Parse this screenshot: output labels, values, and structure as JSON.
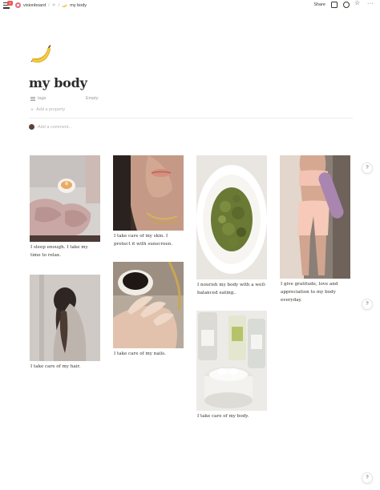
{
  "topbar": {
    "notification_count": "1",
    "breadcrumbs": [
      {
        "label": "visionboard"
      },
      {
        "label": ""
      },
      {
        "label": "my body"
      }
    ],
    "share_label": "Share"
  },
  "page": {
    "emoji": "banana-icon",
    "title": "my body",
    "properties": [
      {
        "name": "tags",
        "value": "Empty"
      }
    ],
    "add_property_label": "Add a property",
    "add_comment_placeholder": "Add a comment..."
  },
  "gallery": {
    "cards": [
      {
        "caption": "I sleep enough. I take my time to relax."
      },
      {
        "caption": "I take care of my hair."
      },
      {
        "caption": "I take care of my skin. I protect it with sunscreen."
      },
      {
        "caption": "I take care of my nails."
      },
      {
        "caption": "I nourish my body with a well-balanced eating.."
      },
      {
        "caption": "I take care of my body."
      },
      {
        "caption": "I give gratitude, love and appreciation to my body everyday."
      }
    ]
  },
  "help_label": "?"
}
